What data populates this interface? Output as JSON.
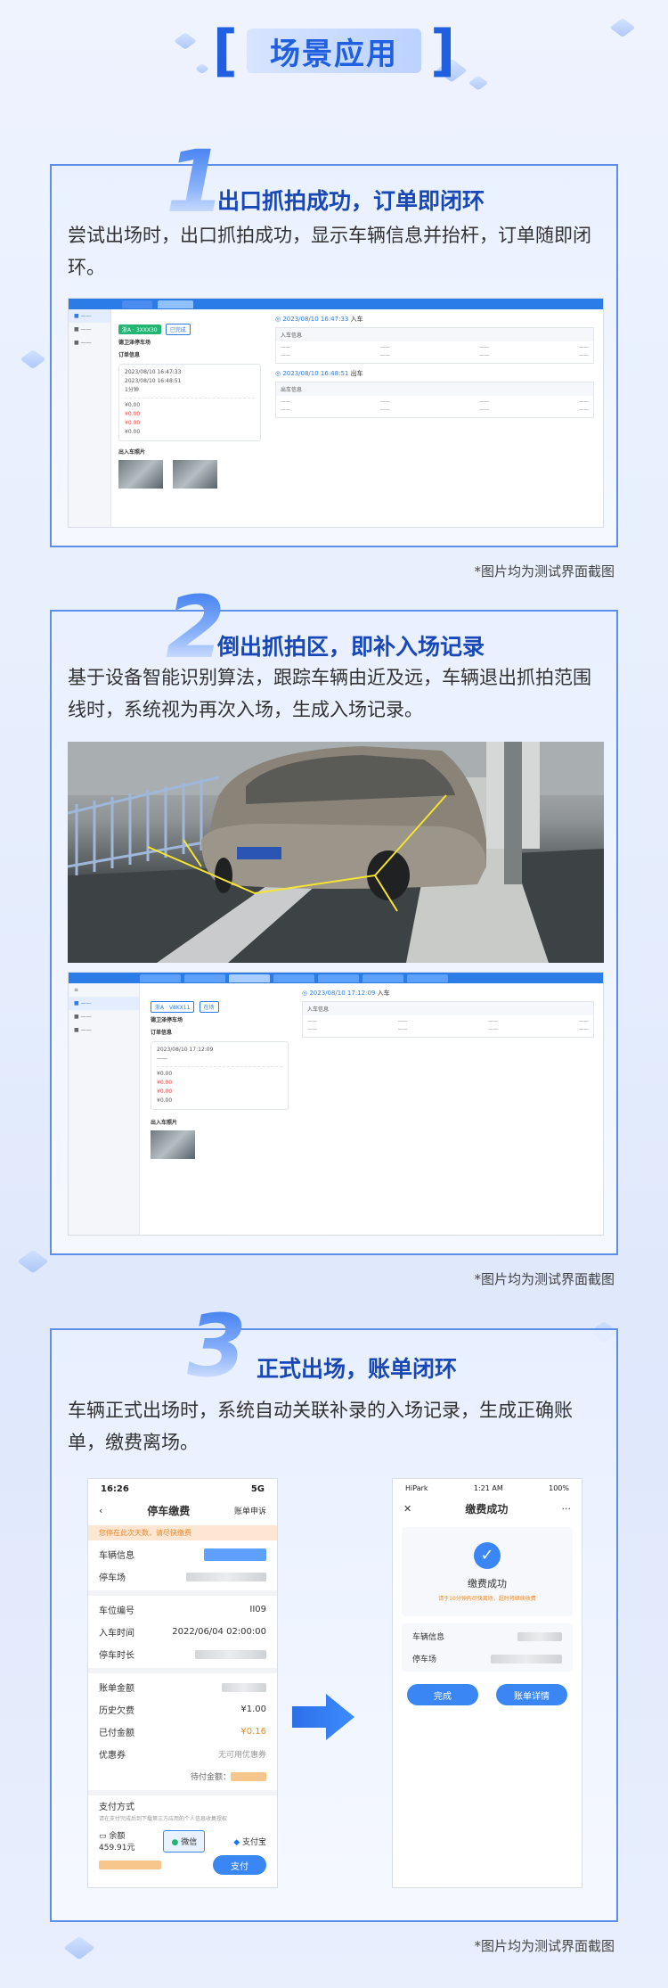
{
  "header": {
    "title": "场景应用",
    "bracket_left": "[",
    "bracket_right": "]"
  },
  "sections": [
    {
      "num": "1",
      "title": "出口抓拍成功，订单即闭环",
      "desc": "尝试出场时，出口抓拍成功，显示车辆信息并抬杆，订单随即闭环。",
      "caption": "*图片均为测试界面截图"
    },
    {
      "num": "2",
      "title": "倒出抓拍区，即补入场记录",
      "desc": "基于设备智能识别算法，跟踪车辆由近及远，车辆退出抓拍范围线时，系统视为再次入场，生成入场记录。",
      "caption": "*图片均为测试界面截图"
    },
    {
      "num": "3",
      "title": "正式出场，账单闭环",
      "desc": "车辆正式出场时，系统自动关联补录的入场记录，生成正确账单，缴费离场。",
      "caption": "*图片均为测试界面截图"
    }
  ],
  "desk1": {
    "plate_tag": "浙A · 3XXX30",
    "status_tag": "已完成",
    "lot_name": "德卫泽停车场",
    "order_label": "订单信息",
    "entry_time": "2023/08/10 16:47:33",
    "exit_time": "2023/08/10 16:48:51",
    "duration": "1分钟",
    "fee_total": "¥0.00",
    "fee_paid": "¥0.00",
    "fee_discount": "¥0.00",
    "fee_due": "¥0.00",
    "photos_label": "出入车照片",
    "rec1_time": "2023/08/10 16:47:33",
    "rec1_type": "入车",
    "rec1_head": "入车信息",
    "rec2_time": "2023/08/10 16:48:51",
    "rec2_type": "出车",
    "rec2_head": "出车信息"
  },
  "desk2": {
    "plate_tag": "浙A · V8KX11",
    "status_tag": "在场",
    "lot_name": "德卫泽停车场",
    "order_label": "订单信息",
    "entry_time": "2023/08/10 17:12:09",
    "fee_total": "¥0.00",
    "fee_paid": "¥0.00",
    "fee_discount": "¥0.00",
    "fee_due": "¥0.00",
    "photos_label": "出入车照片",
    "rec1_time": "2023/08/10 17:12:09",
    "rec1_type": "入车",
    "rec1_head": "入车信息"
  },
  "phone1": {
    "time": "16:26",
    "signal": "5G",
    "title": "停车缴费",
    "right_link": "账单申诉",
    "warning": "您停在此次天数，请尽快缴费",
    "vehicle_label": "车辆信息",
    "lot_label": "停车场",
    "space_label": "车位编号",
    "space_value": "II09",
    "entry_label": "入车时间",
    "entry_value": "2022/06/04 02:00:00",
    "duration_label": "停车时长",
    "bill_label": "账单金额",
    "history_label": "历史欠费",
    "history_value": "¥1.00",
    "paid_label": "已付金额",
    "paid_value": "¥0.16",
    "coupon_label": "优惠券",
    "coupon_value": "无可用优惠券",
    "due_label": "待付金额：",
    "pay_method": "支付方式",
    "pay_hint": "请在支付完成后到下载第三方应用的个人信息收集授权",
    "balance_label": "余额",
    "balance_value": "459.91元",
    "wechat": "微信",
    "alipay": "支付宝",
    "pay_button": "支付"
  },
  "phone2": {
    "carrier": "HiPark",
    "time": "1:21 AM",
    "battery": "100%",
    "title": "缴费成功",
    "success_text": "缴费成功",
    "success_hint": "请于10分钟内尽快离场，超时将继续收费",
    "vehicle_label": "车辆信息",
    "lot_label": "停车场",
    "done_button": "完成",
    "detail_button": "账单详情"
  }
}
